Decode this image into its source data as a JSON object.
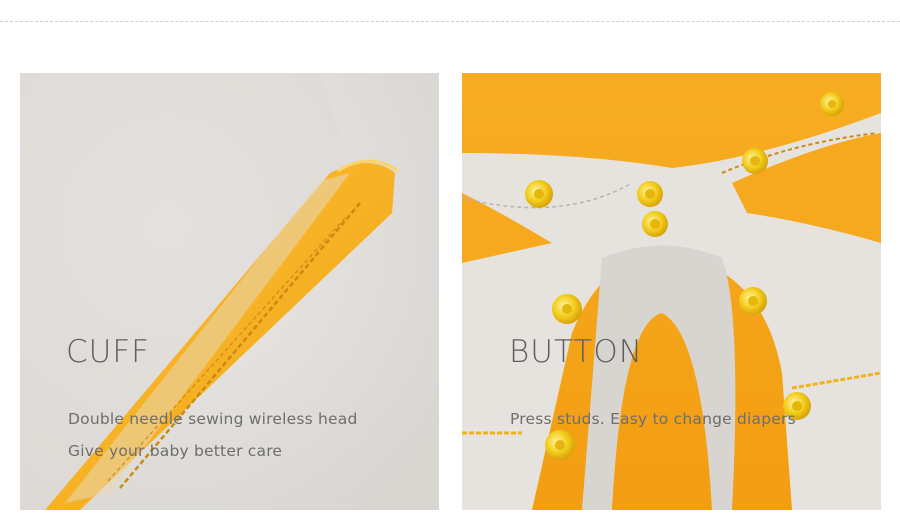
{
  "panels": {
    "cuff": {
      "heading": "CUFF",
      "caption_line1": "Double needle sewing wireless head",
      "caption_line2": "Give your baby better care"
    },
    "button": {
      "heading": "BUTTON",
      "caption_line1": "Press studs. Easy to change diapers"
    }
  },
  "colors": {
    "fabric_grey": "#e4e2df",
    "fabric_yellow": "#f6a81e",
    "snap_yellow": "#f2cc1a",
    "stitch": "#c98a10"
  }
}
